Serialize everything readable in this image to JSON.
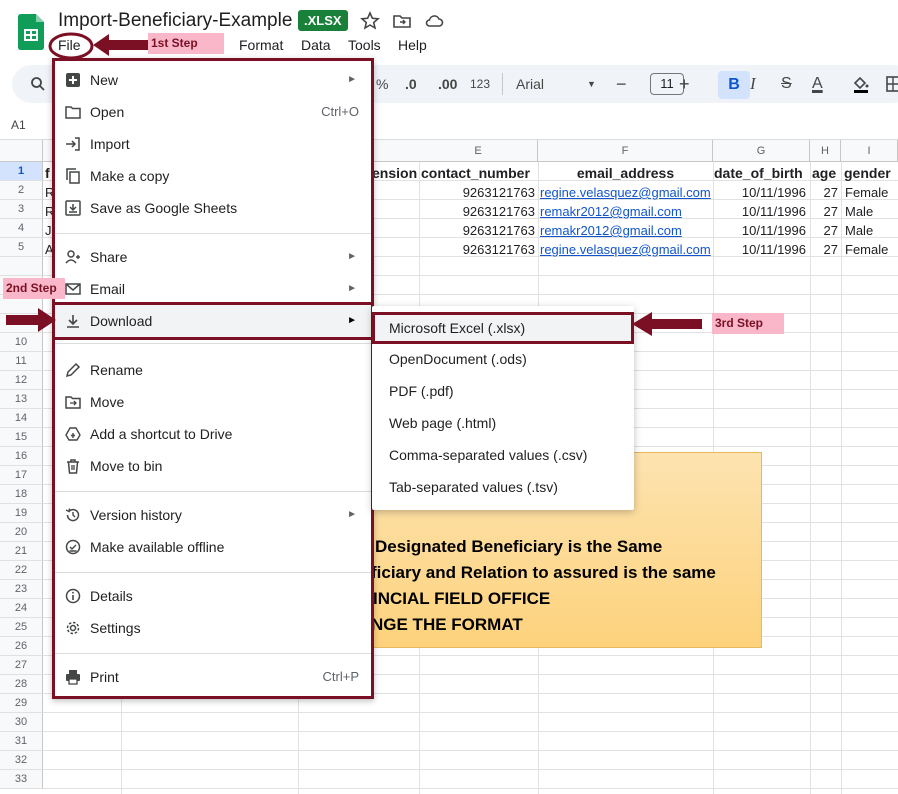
{
  "document": {
    "title": "Import-Beneficiary-Example",
    "format_badge": ".XLSX"
  },
  "menubar": {
    "file": "File",
    "format": "Format",
    "data": "Data",
    "tools": "Tools",
    "help": "Help"
  },
  "toolbar": {
    "percent": "%",
    "dec_decrease": ".0",
    "dec_increase": ".00",
    "number_format": "123",
    "font": "Arial",
    "minus": "−",
    "font_size": "11",
    "plus": "+",
    "bold": "B",
    "italic": "I",
    "strike": "S",
    "text_color": "A"
  },
  "cell_ref": "A1",
  "columns": [
    "E",
    "F",
    "G",
    "H",
    "I"
  ],
  "rows": [
    "1",
    "2",
    "3",
    "4",
    "5",
    "",
    "",
    "",
    "",
    "10",
    "11",
    "12",
    "13",
    "14",
    "15",
    "16",
    "17",
    "18",
    "19",
    "20",
    "21",
    "22",
    "23",
    "24",
    "25",
    "26",
    "27",
    "28",
    "29",
    "30",
    "31",
    "32",
    "33"
  ],
  "sheet": {
    "headers": {
      "a": "f",
      "d": "ension",
      "e": "contact_number",
      "f": "email_address",
      "g": "date_of_birth",
      "h": "age",
      "i": "gender"
    },
    "row_stubs": [
      "R",
      "R",
      "J",
      "A"
    ],
    "data": [
      {
        "contact": "9263121763",
        "email": "regine.velasquez@gmail.com",
        "dob": "10/11/1996",
        "age": "27",
        "gender": "Female"
      },
      {
        "contact": "9263121763",
        "email": "remakr2012@gmail.com",
        "dob": "10/11/1996",
        "age": "27",
        "gender": "Male"
      },
      {
        "contact": "9263121763",
        "email": "remakr2012@gmail.com",
        "dob": "10/11/1996",
        "age": "27",
        "gender": "Male"
      },
      {
        "contact": "9263121763",
        "email": "regine.velasquez@gmail.com",
        "dob": "10/11/1996",
        "age": "27",
        "gender": "Female"
      }
    ]
  },
  "note": {
    "lines": [
      "Designated Beneficiary is the Same",
      "ficiary and Relation to assured is the same",
      "INCIAL FIELD OFFICE",
      "NGE THE FORMAT"
    ]
  },
  "file_menu": {
    "new": "New",
    "open": "Open",
    "open_shortcut": "Ctrl+O",
    "import": "Import",
    "make_copy": "Make a copy",
    "save_as_sheets": "Save as Google Sheets",
    "share": "Share",
    "email": "Email",
    "download": "Download",
    "rename": "Rename",
    "move": "Move",
    "add_shortcut": "Add a shortcut to Drive",
    "move_to_bin": "Move to bin",
    "version_history": "Version history",
    "offline": "Make available offline",
    "details": "Details",
    "settings": "Settings",
    "print": "Print",
    "print_shortcut": "Ctrl+P"
  },
  "download_menu": {
    "xlsx": "Microsoft Excel (.xlsx)",
    "ods": "OpenDocument (.ods)",
    "pdf": "PDF (.pdf)",
    "html": "Web page (.html)",
    "csv": "Comma-separated values (.csv)",
    "tsv": "Tab-separated values (.tsv)"
  },
  "annotations": {
    "step1": "1st Step",
    "step2": "2nd Step",
    "step3": "3rd Step"
  },
  "colors": {
    "annotation_border": "#7b1024",
    "annotation_label_bg": "#f9b7c9",
    "sheets_green": "#188038",
    "link": "#1155cc"
  }
}
